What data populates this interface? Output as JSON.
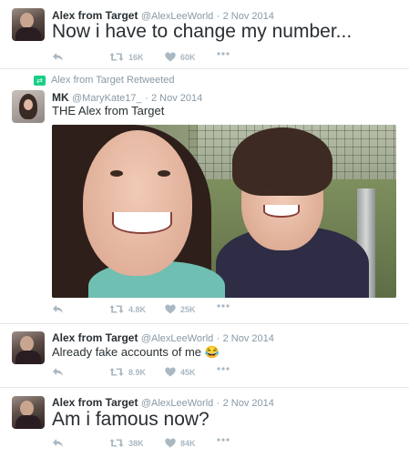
{
  "tweets": [
    {
      "name": "Alex from Target",
      "handle": "@AlexLeeWorld",
      "date": "2 Nov 2014",
      "text": "Now i have to change my number...",
      "retweets": "16K",
      "likes": "60K"
    },
    {
      "retweet_notice": "Alex from Target Retweeted",
      "name": "MK",
      "handle": "@MaryKate17_",
      "date": "2 Nov 2014",
      "text": "THE Alex from Target",
      "retweets": "4.8K",
      "likes": "25K"
    },
    {
      "name": "Alex from Target",
      "handle": "@AlexLeeWorld",
      "date": "2 Nov 2014",
      "text": "Already fake accounts of me 😂",
      "retweets": "8.9K",
      "likes": "45K"
    },
    {
      "name": "Alex from Target",
      "handle": "@AlexLeeWorld",
      "date": "2 Nov 2014",
      "text": "Am i famous now?",
      "retweets": "38K",
      "likes": "84K"
    }
  ],
  "separator": "·",
  "icons": {
    "reply": "reply-icon",
    "retweet": "retweet-icon",
    "like": "heart-icon",
    "more": "more-icon"
  },
  "colors": {
    "icon": "#aab8c2",
    "meta": "#8899a6",
    "retweet_badge": "#19cf86"
  }
}
